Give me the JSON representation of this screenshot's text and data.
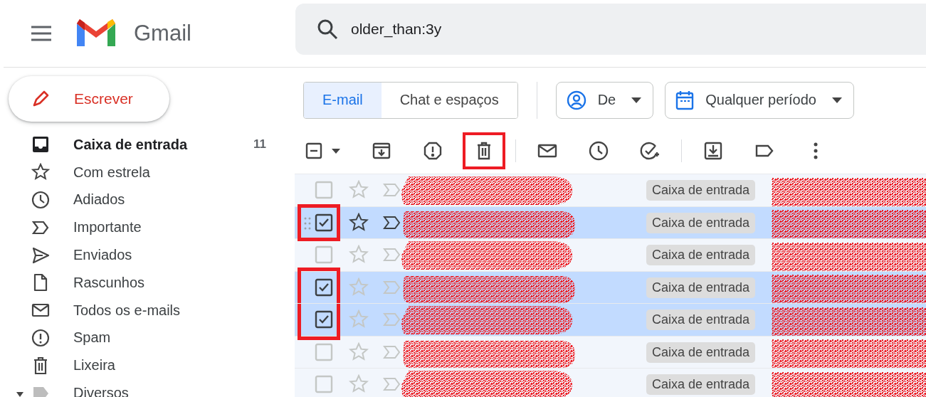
{
  "app": {
    "name": "Gmail"
  },
  "search": {
    "value": "older_than:3y"
  },
  "compose": {
    "label": "Escrever"
  },
  "sidebar": {
    "items": [
      {
        "label": "Caixa de entrada",
        "count": "11",
        "bold": true
      },
      {
        "label": "Com estrela",
        "bold": false
      },
      {
        "label": "Adiados",
        "bold": false
      },
      {
        "label": "Importante",
        "bold": false
      },
      {
        "label": "Enviados",
        "bold": false
      },
      {
        "label": "Rascunhos",
        "bold": false
      },
      {
        "label": "Todos os e-mails",
        "bold": false
      },
      {
        "label": "Spam",
        "bold": false
      },
      {
        "label": "Lixeira",
        "bold": false
      },
      {
        "label": "Diversos",
        "bold": false,
        "expanded": true
      }
    ]
  },
  "tabs": [
    {
      "label": "E-mail",
      "selected": true
    },
    {
      "label": "Chat e espaços",
      "selected": false
    }
  ],
  "filters": [
    {
      "label": "De"
    },
    {
      "label": "Qualquer período"
    }
  ],
  "toolbar": [
    {
      "highlighted": false,
      "indeterminate": true
    },
    {
      "highlighted": false
    },
    {
      "highlighted": false
    },
    {
      "highlighted": true
    },
    {
      "highlighted": false
    },
    {
      "highlighted": false
    },
    {
      "highlighted": false
    },
    {
      "highlighted": false
    },
    {
      "highlighted": false
    },
    {
      "highlighted": false
    }
  ],
  "rows": [
    {
      "checked": false,
      "selected": false,
      "hovered": false,
      "highlighted": false,
      "label": "Caixa de entrada",
      "redacted": true
    },
    {
      "checked": true,
      "selected": true,
      "hovered": true,
      "highlighted": true,
      "label": "Caixa de entrada",
      "redacted": true
    },
    {
      "checked": false,
      "selected": false,
      "hovered": false,
      "highlighted": false,
      "label": "Caixa de entrada",
      "redacted": true
    },
    {
      "checked": true,
      "selected": true,
      "hovered": false,
      "highlighted": true,
      "label": "Caixa de entrada",
      "redacted": true
    },
    {
      "checked": true,
      "selected": true,
      "hovered": false,
      "highlighted": true,
      "label": "Caixa de entrada",
      "redacted": true
    },
    {
      "checked": false,
      "selected": false,
      "hovered": false,
      "highlighted": false,
      "label": "Caixa de entrada",
      "redacted": true
    },
    {
      "checked": false,
      "selected": false,
      "hovered": false,
      "highlighted": false,
      "label": "Caixa de entrada",
      "redacted": true
    }
  ]
}
